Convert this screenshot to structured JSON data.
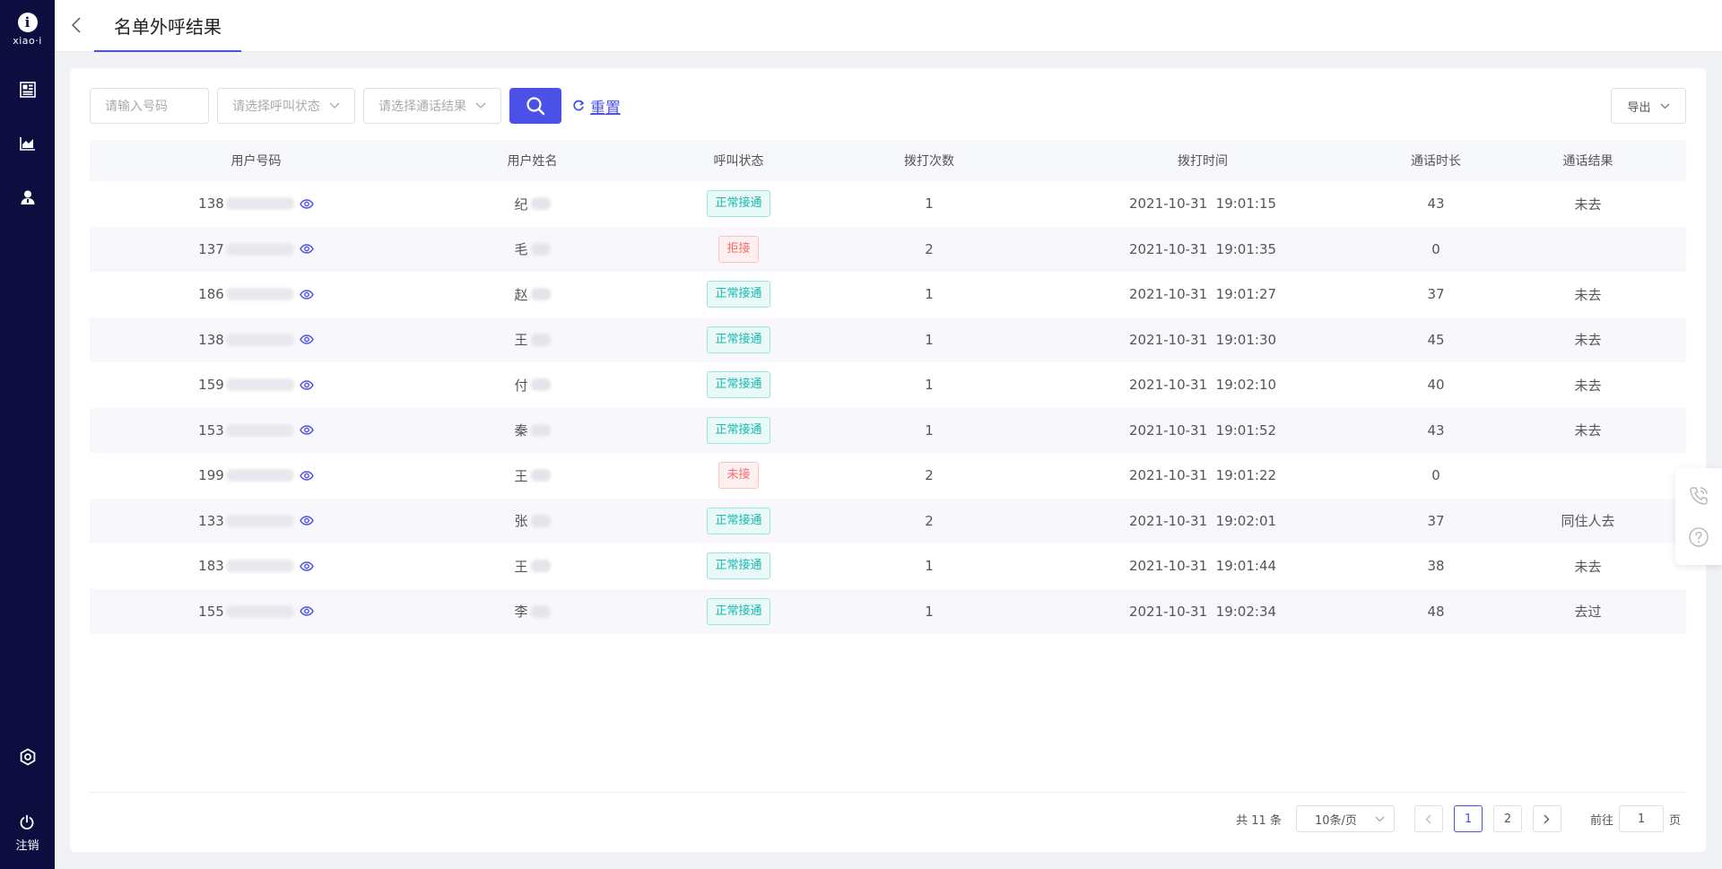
{
  "brand": {
    "logo_mark": "i",
    "logo_text": "xiao·i"
  },
  "sidebar": {
    "items": [
      {
        "name": "dashboard-icon"
      },
      {
        "name": "chart-icon"
      },
      {
        "name": "user-icon"
      }
    ],
    "settings_icon": "settings-icon",
    "logout_label": "注销"
  },
  "header": {
    "tab_title": "名单外呼结果"
  },
  "filters": {
    "phone_placeholder": "请输入号码",
    "status_placeholder": "请选择呼叫状态",
    "result_placeholder": "请选择通话结果",
    "reset_label": "重置",
    "export_label": "导出"
  },
  "table": {
    "columns": [
      "用户号码",
      "用户姓名",
      "呼叫状态",
      "拨打次数",
      "拨打时间",
      "通话时长",
      "通话结果"
    ],
    "rows": [
      {
        "phone_prefix": "138",
        "name_surname": "纪",
        "status": "正常接通",
        "status_type": "ok",
        "dial_count": "1",
        "dial_time": "2021-10-31  19:01:15",
        "duration": "43",
        "result": "未去"
      },
      {
        "phone_prefix": "137",
        "name_surname": "毛",
        "status": "拒接",
        "status_type": "bad",
        "dial_count": "2",
        "dial_time": "2021-10-31  19:01:35",
        "duration": "0",
        "result": ""
      },
      {
        "phone_prefix": "186",
        "name_surname": "赵",
        "status": "正常接通",
        "status_type": "ok",
        "dial_count": "1",
        "dial_time": "2021-10-31  19:01:27",
        "duration": "37",
        "result": "未去"
      },
      {
        "phone_prefix": "138",
        "name_surname": "王",
        "status": "正常接通",
        "status_type": "ok",
        "dial_count": "1",
        "dial_time": "2021-10-31  19:01:30",
        "duration": "45",
        "result": "未去"
      },
      {
        "phone_prefix": "159",
        "name_surname": "付",
        "status": "正常接通",
        "status_type": "ok",
        "dial_count": "1",
        "dial_time": "2021-10-31  19:02:10",
        "duration": "40",
        "result": "未去"
      },
      {
        "phone_prefix": "153",
        "name_surname": "秦",
        "status": "正常接通",
        "status_type": "ok",
        "dial_count": "1",
        "dial_time": "2021-10-31  19:01:52",
        "duration": "43",
        "result": "未去"
      },
      {
        "phone_prefix": "199",
        "name_surname": "王",
        "status": "未接",
        "status_type": "bad",
        "dial_count": "2",
        "dial_time": "2021-10-31  19:01:22",
        "duration": "0",
        "result": ""
      },
      {
        "phone_prefix": "133",
        "name_surname": "张",
        "status": "正常接通",
        "status_type": "ok",
        "dial_count": "2",
        "dial_time": "2021-10-31  19:02:01",
        "duration": "37",
        "result": "同住人去"
      },
      {
        "phone_prefix": "183",
        "name_surname": "王",
        "status": "正常接通",
        "status_type": "ok",
        "dial_count": "1",
        "dial_time": "2021-10-31  19:01:44",
        "duration": "38",
        "result": "未去"
      },
      {
        "phone_prefix": "155",
        "name_surname": "李",
        "status": "正常接通",
        "status_type": "ok",
        "dial_count": "1",
        "dial_time": "2021-10-31  19:02:34",
        "duration": "48",
        "result": "去过"
      }
    ]
  },
  "pagination": {
    "total_text": "共 11 条",
    "page_size": "10条/页",
    "pages": [
      "1",
      "2"
    ],
    "current_page": "1",
    "goto_prefix": "前往",
    "goto_value": "1",
    "goto_suffix": "页"
  },
  "float_tools": [
    {
      "name": "phone-call-icon"
    },
    {
      "name": "help-icon"
    }
  ],
  "colors": {
    "sidebar_bg": "#0e0d40",
    "accent": "#4b50e6",
    "status_ok": "#1bb9b0",
    "status_bad": "#f56c6c"
  }
}
